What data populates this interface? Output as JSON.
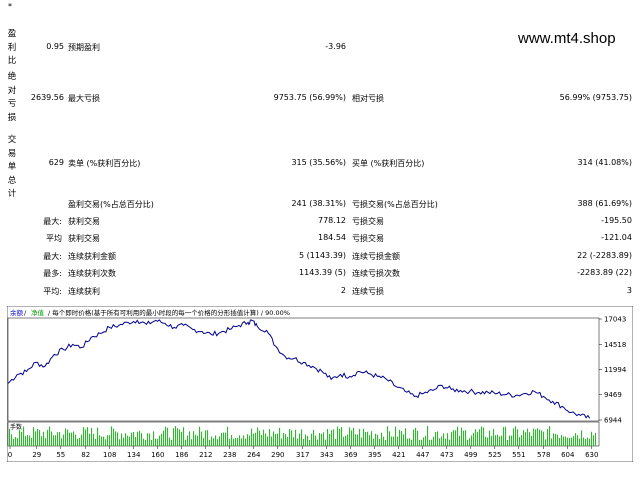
{
  "watermark": "www.mt4.shop",
  "side_labels": {
    "profit_ratio": [
      "盈",
      "利",
      "比"
    ],
    "absolute_drawdown": [
      "绝",
      "对",
      "亏",
      "损"
    ],
    "total_trades": [
      "交",
      "易",
      "单",
      "总",
      "计"
    ]
  },
  "top_marker": "*",
  "rows": [
    {
      "id": "r1",
      "top": 47,
      "v1": "0.95",
      "l2": "预期盈利",
      "v2": "-3.96",
      "l3": "",
      "v3": ""
    },
    {
      "id": "r2",
      "top": 98,
      "v1": "2639.56",
      "l2": "最大亏损",
      "v2": "9753.75 (56.99%)",
      "l3": "相对亏损",
      "v3": "56.99% (9753.75)"
    },
    {
      "id": "r3",
      "top": 163,
      "v1": "629",
      "l2": "卖单 (%获利百分比)",
      "v2": "315 (35.56%)",
      "l3": "买单 (%获利百分比)",
      "v3": "314 (41.08%)"
    },
    {
      "id": "r4",
      "top": 204,
      "v1": "",
      "l2": "盈利交易(%占总百分比)",
      "v2": "241 (38.31%)",
      "l3": "亏损交易(%占总百分比)",
      "v3": "388 (61.69%)"
    },
    {
      "id": "r5",
      "top": 221,
      "l1": "最大:",
      "l2": "获利交易",
      "v2": "778.12",
      "l3": "亏损交易",
      "v3": "-195.50"
    },
    {
      "id": "r6",
      "top": 238,
      "l1": "平均",
      "l2": "获利交易",
      "v2": "184.54",
      "l3": "亏损交易",
      "v3": "-121.04"
    },
    {
      "id": "r7",
      "top": 256,
      "l1": "最大:",
      "l2": "连续获利金额",
      "v2": "5 (1143.39)",
      "l3": "连续亏损金额",
      "v3": "22 (-2283.89)"
    },
    {
      "id": "r8",
      "top": 273,
      "l1": "最多:",
      "l2": "连续获利次数",
      "v2": "1143.39 (5)",
      "l3": "连续亏损次数",
      "v3": "-2283.89 (22)"
    },
    {
      "id": "r9",
      "top": 291,
      "l1": "平均:",
      "l2": "连续获利",
      "v2": "2",
      "l3": "连续亏损",
      "v3": "3"
    }
  ],
  "chart_data": {
    "type": "line",
    "legend": {
      "balance": "余额",
      "separator": " / ",
      "equity": "净值",
      "text": "每个即时价格(基于所有可利用的最小时段的每一个价格的分形插值计算)",
      "quality": "90.00%"
    },
    "ylim": [
      6944,
      17043
    ],
    "y_ticks": [
      "17043",
      "14518",
      "11994",
      "9469",
      "6944"
    ],
    "x_ticks": [
      "0",
      "29",
      "55",
      "82",
      "108",
      "134",
      "160",
      "186",
      "212",
      "238",
      "264",
      "290",
      "317",
      "343",
      "369",
      "395",
      "421",
      "447",
      "473",
      "499",
      "525",
      "551",
      "578",
      "604",
      "630"
    ],
    "x_range": [
      0,
      640
    ],
    "series": [
      {
        "color": "#00008b",
        "points": [
          [
            0,
            10600
          ],
          [
            10,
            11500
          ],
          [
            20,
            11800
          ],
          [
            30,
            12700
          ],
          [
            40,
            12300
          ],
          [
            50,
            13500
          ],
          [
            60,
            14000
          ],
          [
            70,
            14500
          ],
          [
            80,
            14200
          ],
          [
            90,
            15200
          ],
          [
            100,
            15600
          ],
          [
            110,
            16200
          ],
          [
            120,
            16400
          ],
          [
            130,
            16700
          ],
          [
            140,
            16900
          ],
          [
            150,
            16500
          ],
          [
            160,
            16900
          ],
          [
            170,
            16600
          ],
          [
            180,
            16200
          ],
          [
            190,
            16400
          ],
          [
            200,
            16000
          ],
          [
            210,
            15800
          ],
          [
            220,
            15500
          ],
          [
            230,
            15700
          ],
          [
            240,
            16000
          ],
          [
            250,
            16400
          ],
          [
            260,
            16700
          ],
          [
            264,
            16900
          ],
          [
            270,
            16300
          ],
          [
            280,
            15900
          ],
          [
            290,
            14300
          ],
          [
            300,
            13300
          ],
          [
            310,
            13100
          ],
          [
            320,
            12700
          ],
          [
            330,
            12300
          ],
          [
            340,
            11800
          ],
          [
            350,
            11000
          ],
          [
            360,
            11500
          ],
          [
            370,
            11300
          ],
          [
            380,
            11800
          ],
          [
            390,
            11600
          ],
          [
            400,
            11300
          ],
          [
            410,
            11000
          ],
          [
            420,
            10300
          ],
          [
            430,
            9800
          ],
          [
            440,
            9300
          ],
          [
            450,
            9600
          ],
          [
            460,
            9900
          ],
          [
            470,
            10400
          ],
          [
            480,
            10000
          ],
          [
            490,
            9900
          ],
          [
            500,
            9800
          ],
          [
            510,
            9700
          ],
          [
            520,
            9700
          ],
          [
            530,
            9600
          ],
          [
            540,
            9500
          ],
          [
            550,
            9400
          ],
          [
            560,
            9600
          ],
          [
            570,
            9800
          ],
          [
            580,
            9300
          ],
          [
            590,
            8800
          ],
          [
            600,
            8300
          ],
          [
            610,
            7700
          ],
          [
            620,
            7400
          ],
          [
            630,
            7100
          ]
        ]
      }
    ],
    "volume_label": "手数"
  }
}
